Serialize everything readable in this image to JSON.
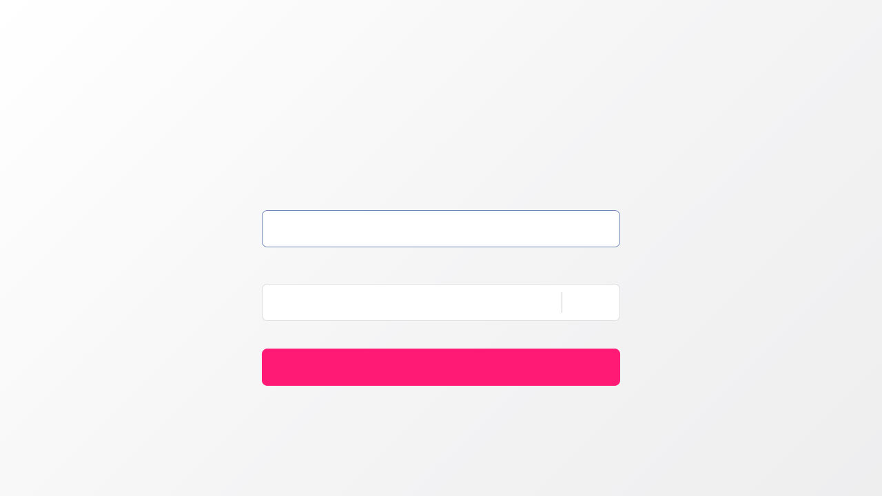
{
  "form": {
    "first_field": {
      "value": "",
      "placeholder": ""
    },
    "second_field": {
      "value": "",
      "placeholder": "",
      "suffix_label": ""
    },
    "submit_label": ""
  },
  "colors": {
    "focus_border": "#6f86b5",
    "field_border": "#dcdcdc",
    "accent": "#ff1a75",
    "background_start": "#ffffff",
    "background_end": "#eeeeef"
  }
}
